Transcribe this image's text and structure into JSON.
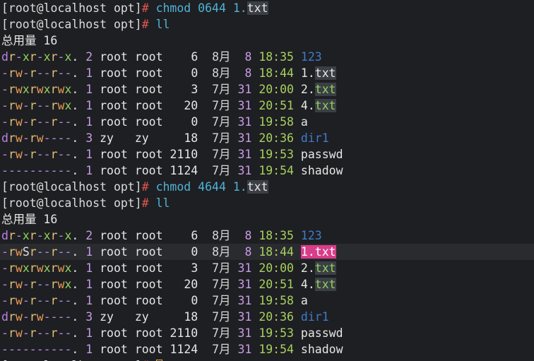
{
  "terminal": {
    "prompt": "[root@localhost opt]",
    "prompt_char": "#",
    "total_label": "总用量 16",
    "blocks": [
      {
        "command": "chmod 0644 1.txt",
        "list_command": "ll",
        "entries": [
          {
            "perm": "dr-xr-xr-x.",
            "links": "2",
            "owner": "root",
            "group": "root",
            "size": "6",
            "month": "8月",
            "day": "8",
            "time": "18:35",
            "name": "123",
            "type": "dir"
          },
          {
            "perm": "-rw-r--r--.",
            "links": "1",
            "owner": "root",
            "group": "root",
            "size": "0",
            "month": "8月",
            "day": "8",
            "time": "18:44",
            "name": "1.txt",
            "type": "file"
          },
          {
            "perm": "-rwxrwxrwx.",
            "links": "1",
            "owner": "root",
            "group": "root",
            "size": "3",
            "month": "7月",
            "day": "31",
            "time": "20:00",
            "name": "2.txt",
            "type": "exec"
          },
          {
            "perm": "-rw-r--rwx.",
            "links": "1",
            "owner": "root",
            "group": "root",
            "size": "20",
            "month": "7月",
            "day": "31",
            "time": "20:51",
            "name": "4.txt",
            "type": "exec"
          },
          {
            "perm": "-rw-r--r--.",
            "links": "1",
            "owner": "root",
            "group": "root",
            "size": "0",
            "month": "7月",
            "day": "31",
            "time": "19:58",
            "name": "a",
            "type": "plain"
          },
          {
            "perm": "drw-rw----.",
            "links": "3",
            "owner": "zy",
            "group": "zy",
            "size": "18",
            "month": "7月",
            "day": "31",
            "time": "20:36",
            "name": "dir1",
            "type": "dir"
          },
          {
            "perm": "-rw-r--r--.",
            "links": "1",
            "owner": "root",
            "group": "root",
            "size": "2110",
            "month": "7月",
            "day": "31",
            "time": "19:53",
            "name": "passwd",
            "type": "plain"
          },
          {
            "perm": "----------.",
            "links": "1",
            "owner": "root",
            "group": "root",
            "size": "1124",
            "month": "7月",
            "day": "31",
            "time": "19:54",
            "name": "shadow",
            "type": "plain"
          }
        ]
      },
      {
        "command": "chmod 4644 1.txt",
        "list_command": "ll",
        "entries": [
          {
            "perm": "dr-xr-xr-x.",
            "links": "2",
            "owner": "root",
            "group": "root",
            "size": "6",
            "month": "8月",
            "day": "8",
            "time": "18:35",
            "name": "123",
            "type": "dir"
          },
          {
            "perm": "-rwSr--r--.",
            "links": "1",
            "owner": "root",
            "group": "root",
            "size": "0",
            "month": "8月",
            "day": "8",
            "time": "18:44",
            "name": "1.txt",
            "type": "setuid"
          },
          {
            "perm": "-rwxrwxrwx.",
            "links": "1",
            "owner": "root",
            "group": "root",
            "size": "3",
            "month": "7月",
            "day": "31",
            "time": "20:00",
            "name": "2.txt",
            "type": "exec"
          },
          {
            "perm": "-rw-r--rwx.",
            "links": "1",
            "owner": "root",
            "group": "root",
            "size": "20",
            "month": "7月",
            "day": "31",
            "time": "20:51",
            "name": "4.txt",
            "type": "exec"
          },
          {
            "perm": "-rw-r--r--.",
            "links": "1",
            "owner": "root",
            "group": "root",
            "size": "0",
            "month": "7月",
            "day": "31",
            "time": "19:58",
            "name": "a",
            "type": "plain"
          },
          {
            "perm": "drw-rw----.",
            "links": "3",
            "owner": "zy",
            "group": "zy",
            "size": "18",
            "month": "7月",
            "day": "31",
            "time": "20:36",
            "name": "dir1",
            "type": "dir"
          },
          {
            "perm": "-rw-r--r--.",
            "links": "1",
            "owner": "root",
            "group": "root",
            "size": "2110",
            "month": "7月",
            "day": "31",
            "time": "19:53",
            "name": "passwd",
            "type": "plain"
          },
          {
            "perm": "----------.",
            "links": "1",
            "owner": "root",
            "group": "root",
            "size": "1124",
            "month": "7月",
            "day": "31",
            "time": "19:54",
            "name": "shadow",
            "type": "plain"
          }
        ]
      }
    ],
    "colors": {
      "background": "#1e1f22",
      "prompt_hash": "#e5554e",
      "command": "#4fb3d9",
      "directory": "#3f7bc9",
      "time": "#a8d15e",
      "setuid_highlight": "#d93d8a"
    }
  }
}
